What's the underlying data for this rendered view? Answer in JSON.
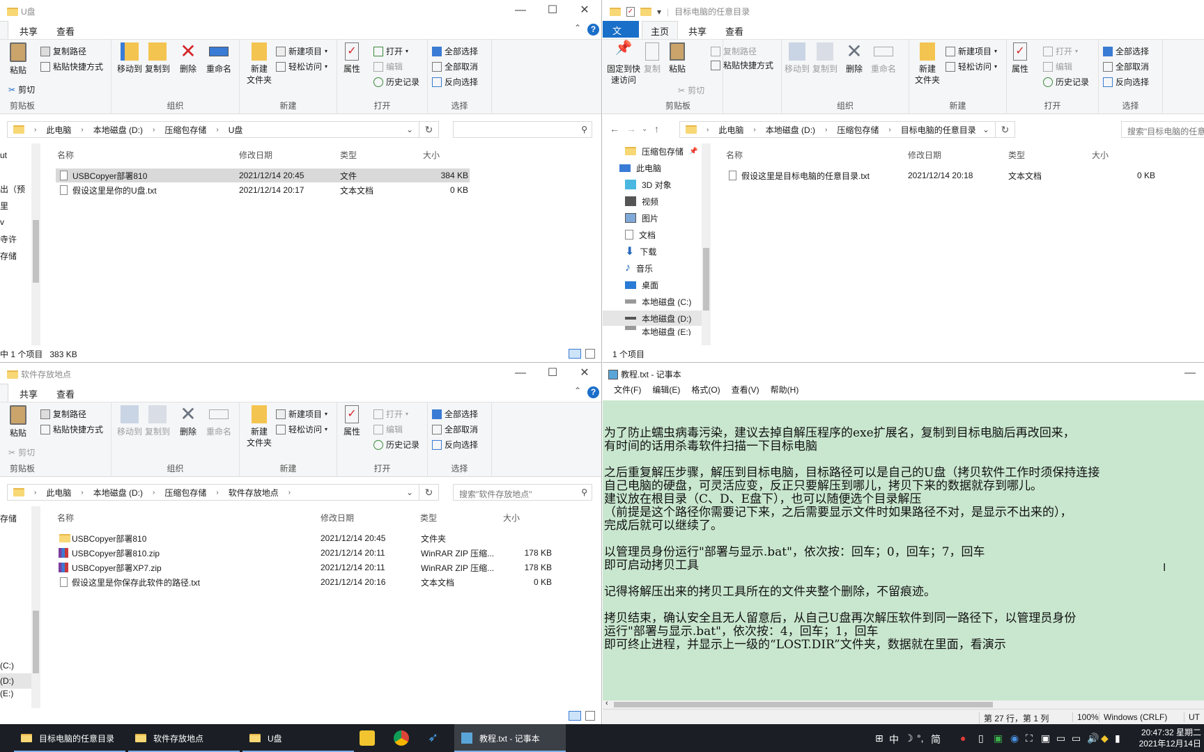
{
  "ribbon": {
    "file_tab": "文件",
    "home_tab": "主页",
    "share_tab": "共享",
    "view_tab": "查看",
    "paste": "粘贴",
    "copy_path": "复制路径",
    "paste_shortcut": "粘贴快捷方式",
    "cut": "剪切",
    "clipboard": "剪贴板",
    "pin_quick": "固定到快\n速访问",
    "copy": "复制",
    "move_to": "移动到",
    "copy_to": "复制到",
    "delete": "删除",
    "rename": "重命名",
    "organize": "组织",
    "new_folder": "新建\n文件夹",
    "new_item": "新建项目",
    "easy_access": "轻松访问",
    "new": "新建",
    "properties": "属性",
    "open": "打开",
    "edit": "编辑",
    "history": "历史记录",
    "open_group": "打开",
    "select_all": "全部选择",
    "select_none": "全部取消",
    "invert": "反向选择",
    "select": "选择"
  },
  "win_usb": {
    "title": "U盘",
    "breadcrumb": [
      "此电脑",
      "本地磁盘 (D:)",
      "压缩包存储",
      "U盘"
    ],
    "cols": [
      "名称",
      "修改日期",
      "类型",
      "大小"
    ],
    "files": [
      {
        "name": "USBCopyer部署810",
        "date": "2021/12/14 20:45",
        "type": "文件",
        "size": "384 KB"
      },
      {
        "name": "假设这里是你的U盘.txt",
        "date": "2021/12/14 20:17",
        "type": "文本文档",
        "size": "0 KB"
      }
    ],
    "status": "中 1 个项目   383 KB",
    "nav_partial": [
      "ut",
      "出（预",
      "里",
      "v",
      "寺许",
      "存储"
    ]
  },
  "win_target": {
    "title": "目标电脑的任意目录",
    "breadcrumb": [
      "此电脑",
      "本地磁盘 (D:)",
      "压缩包存储",
      "目标电脑的任意目录"
    ],
    "search_placeholder": "搜索\"目标电脑的任意",
    "cols": [
      "名称",
      "修改日期",
      "类型",
      "大小"
    ],
    "files": [
      {
        "name": "假设这里是目标电脑的任意目录.txt",
        "date": "2021/12/14 20:18",
        "type": "文本文档",
        "size": "0 KB"
      }
    ],
    "nav": [
      "压缩包存储",
      "此电脑",
      "3D 对象",
      "视频",
      "图片",
      "文档",
      "下载",
      "音乐",
      "桌面",
      "本地磁盘 (C:)",
      "本地磁盘 (D:)",
      "本地磁盘 (E:)"
    ],
    "status": "1 个项目"
  },
  "win_soft": {
    "title": "软件存放地点",
    "breadcrumb": [
      "此电脑",
      "本地磁盘 (D:)",
      "压缩包存储",
      "软件存放地点"
    ],
    "search_placeholder": "搜索\"软件存放地点\"",
    "cols": [
      "名称",
      "修改日期",
      "类型",
      "大小"
    ],
    "files": [
      {
        "name": "USBCopyer部署810",
        "date": "2021/12/14 20:45",
        "type": "文件夹",
        "size": ""
      },
      {
        "name": "USBCopyer部署810.zip",
        "date": "2021/12/14 20:11",
        "type": "WinRAR ZIP 压缩...",
        "size": "178 KB"
      },
      {
        "name": "USBCopyer部署XP7.zip",
        "date": "2021/12/14 20:11",
        "type": "WinRAR ZIP 压缩...",
        "size": "178 KB"
      },
      {
        "name": "假设这里是你保存此软件的路径.txt",
        "date": "2021/12/14 20:16",
        "type": "文本文档",
        "size": "0 KB"
      }
    ],
    "nav_partial": [
      "存储",
      "(C:)",
      "(D:)",
      "(E:)"
    ]
  },
  "notepad": {
    "title": "教程.txt - 记事本",
    "menu": [
      "文件(F)",
      "编辑(E)",
      "格式(O)",
      "查看(V)",
      "帮助(H)"
    ],
    "lines": [
      "为了防止蠕虫病毒污染，建议去掉自解压程序的exe扩展名，复制到目标电脑后再改回来，",
      "有时间的话用杀毒软件扫描一下目标电脑",
      "",
      "之后重复解压步骤，解压到目标电脑，目标路径可以是自己的U盘（拷贝软件工作时须保持连接",
      "自己电脑的硬盘，可灵活应变，反正只要解压到哪儿，拷贝下来的数据就存到哪儿。",
      "建议放在根目录（C、D、E盘下），也可以随便选个目录解压",
      "（前提是这个路径你需要记下来，之后需要显示文件时如果路径不对，是显示不出来的），",
      "完成后就可以继续了。",
      "",
      "以管理员身份运行\"部署与显示.bat\"，依次按：回车；0，回车；7，回车",
      "即可启动拷贝工具",
      "",
      "记得将解压出来的拷贝工具所在的文件夹整个删除，不留痕迹。",
      "",
      "拷贝结束，确认安全且无人留意后，从自己U盘再次解压软件到同一路径下，以管理员身份",
      "运行\"部署与显示.bat\"，依次按：4，回车；1，回车",
      "即可终止进程，并显示上一级的“LOST.DIR”文件夹，数据就在里面，看演示"
    ],
    "status_pos": "第 27 行，第 1 列",
    "zoom": "100%",
    "eol": "Windows (CRLF)",
    "enc": "UT"
  },
  "taskbar": {
    "items": [
      "目标电脑的任意目录",
      "软件存放地点",
      "U盘",
      "教程.txt - 记事本"
    ],
    "ime": "中",
    "ime2": "简",
    "time": "20:47:32 星期二",
    "date": "2021年12月14日"
  }
}
